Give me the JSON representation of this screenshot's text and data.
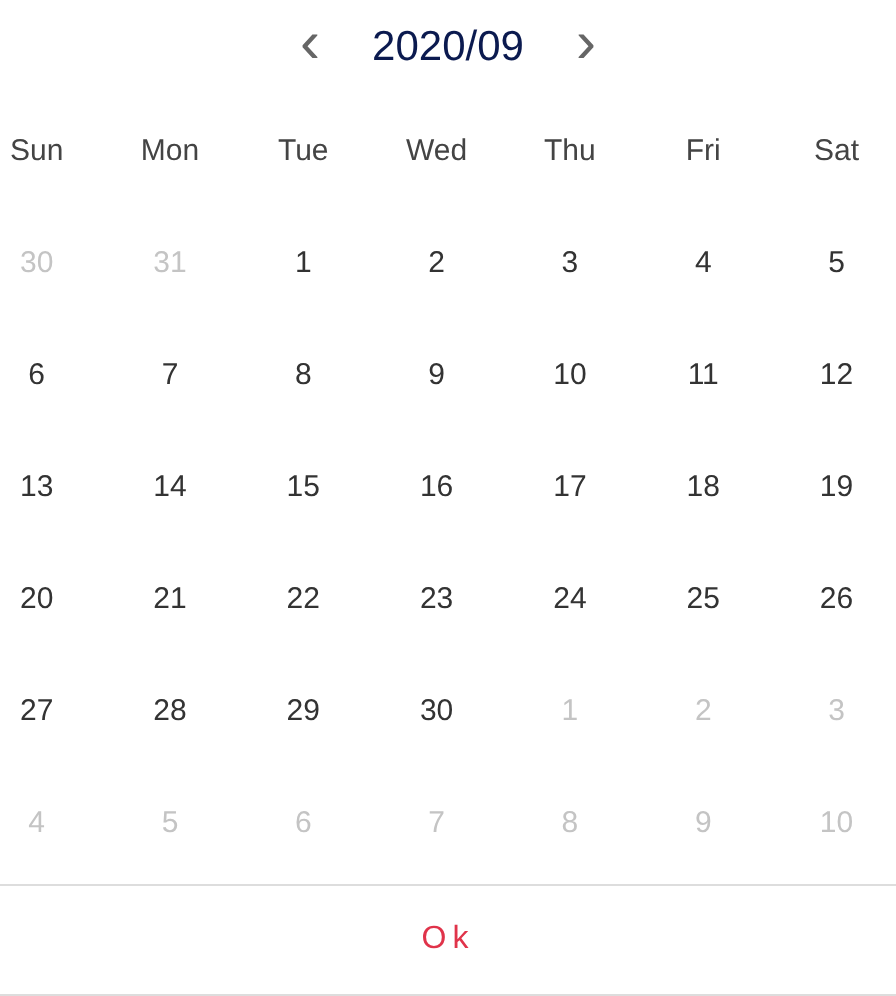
{
  "header": {
    "prev": "‹",
    "title": "2020/09",
    "next": "›"
  },
  "weekdays": [
    "Sun",
    "Mon",
    "Tue",
    "Wed",
    "Thu",
    "Fri",
    "Sat"
  ],
  "weeks": [
    [
      {
        "day": "30",
        "muted": true
      },
      {
        "day": "31",
        "muted": true
      },
      {
        "day": "1",
        "muted": false
      },
      {
        "day": "2",
        "muted": false
      },
      {
        "day": "3",
        "muted": false
      },
      {
        "day": "4",
        "muted": false
      },
      {
        "day": "5",
        "muted": false
      }
    ],
    [
      {
        "day": "6",
        "muted": false
      },
      {
        "day": "7",
        "muted": false
      },
      {
        "day": "8",
        "muted": false
      },
      {
        "day": "9",
        "muted": false
      },
      {
        "day": "10",
        "muted": false
      },
      {
        "day": "11",
        "muted": false
      },
      {
        "day": "12",
        "muted": false
      }
    ],
    [
      {
        "day": "13",
        "muted": false
      },
      {
        "day": "14",
        "muted": false
      },
      {
        "day": "15",
        "muted": false
      },
      {
        "day": "16",
        "muted": false
      },
      {
        "day": "17",
        "muted": false
      },
      {
        "day": "18",
        "muted": false
      },
      {
        "day": "19",
        "muted": false
      }
    ],
    [
      {
        "day": "20",
        "muted": false
      },
      {
        "day": "21",
        "muted": false
      },
      {
        "day": "22",
        "muted": false
      },
      {
        "day": "23",
        "muted": false
      },
      {
        "day": "24",
        "muted": false
      },
      {
        "day": "25",
        "muted": false
      },
      {
        "day": "26",
        "muted": false
      }
    ],
    [
      {
        "day": "27",
        "muted": false
      },
      {
        "day": "28",
        "muted": false
      },
      {
        "day": "29",
        "muted": false
      },
      {
        "day": "30",
        "muted": false
      },
      {
        "day": "1",
        "muted": true
      },
      {
        "day": "2",
        "muted": true
      },
      {
        "day": "3",
        "muted": true
      }
    ],
    [
      {
        "day": "4",
        "muted": true
      },
      {
        "day": "5",
        "muted": true
      },
      {
        "day": "6",
        "muted": true
      },
      {
        "day": "7",
        "muted": true
      },
      {
        "day": "8",
        "muted": true
      },
      {
        "day": "9",
        "muted": true
      },
      {
        "day": "10",
        "muted": true
      }
    ]
  ],
  "ok_button": "Ok"
}
